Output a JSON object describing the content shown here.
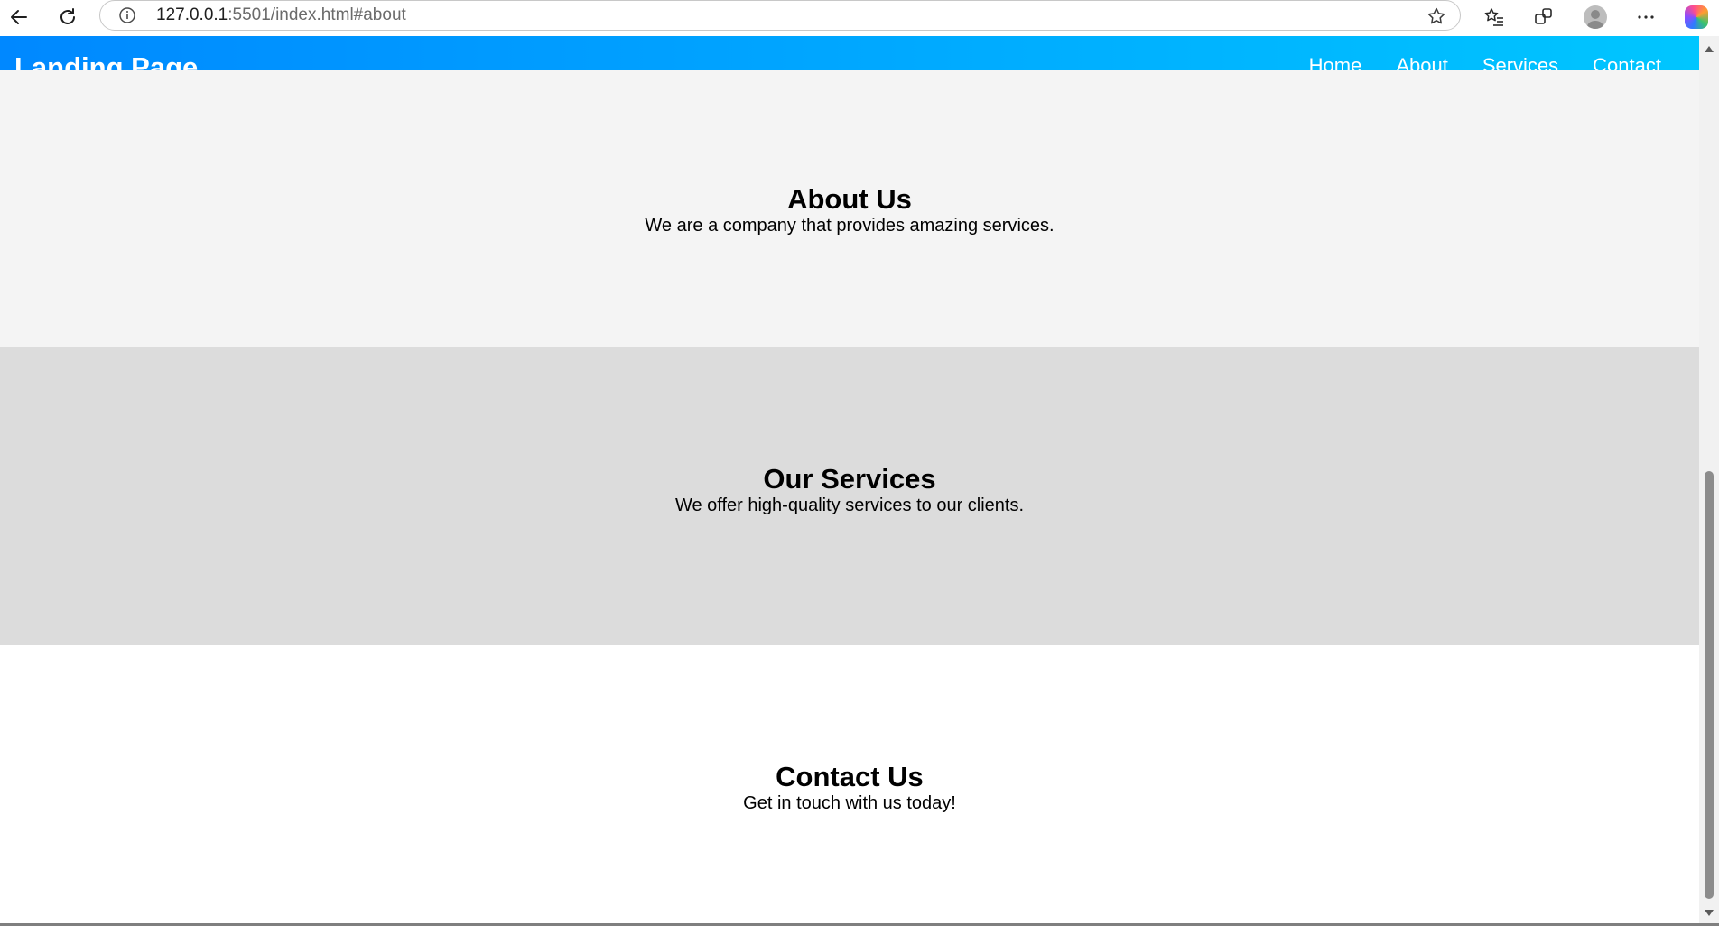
{
  "browser": {
    "url_host": "127.0.0.1",
    "url_rest": ":5501/index.html#about",
    "icons": [
      "back-icon",
      "reload-icon",
      "info-icon",
      "star-icon",
      "favorites-icon",
      "extensions-icon",
      "profile-avatar",
      "more-icon",
      "copilot-icon"
    ]
  },
  "site": {
    "logo": "Landing Page",
    "nav": [
      "Home",
      "About",
      "Services",
      "Contact"
    ],
    "header_gradient": [
      "#0088ff",
      "#00c6ff"
    ]
  },
  "sections": {
    "about": {
      "title": "About Us",
      "text": "We are a company that provides amazing services.",
      "bg": "#f4f4f4"
    },
    "services": {
      "title": "Our Services",
      "text": "We offer high-quality services to our clients.",
      "bg": "#dcdcdc"
    },
    "contact": {
      "title": "Contact Us",
      "text": "Get in touch with us today!",
      "bg": "#ffffff"
    }
  }
}
